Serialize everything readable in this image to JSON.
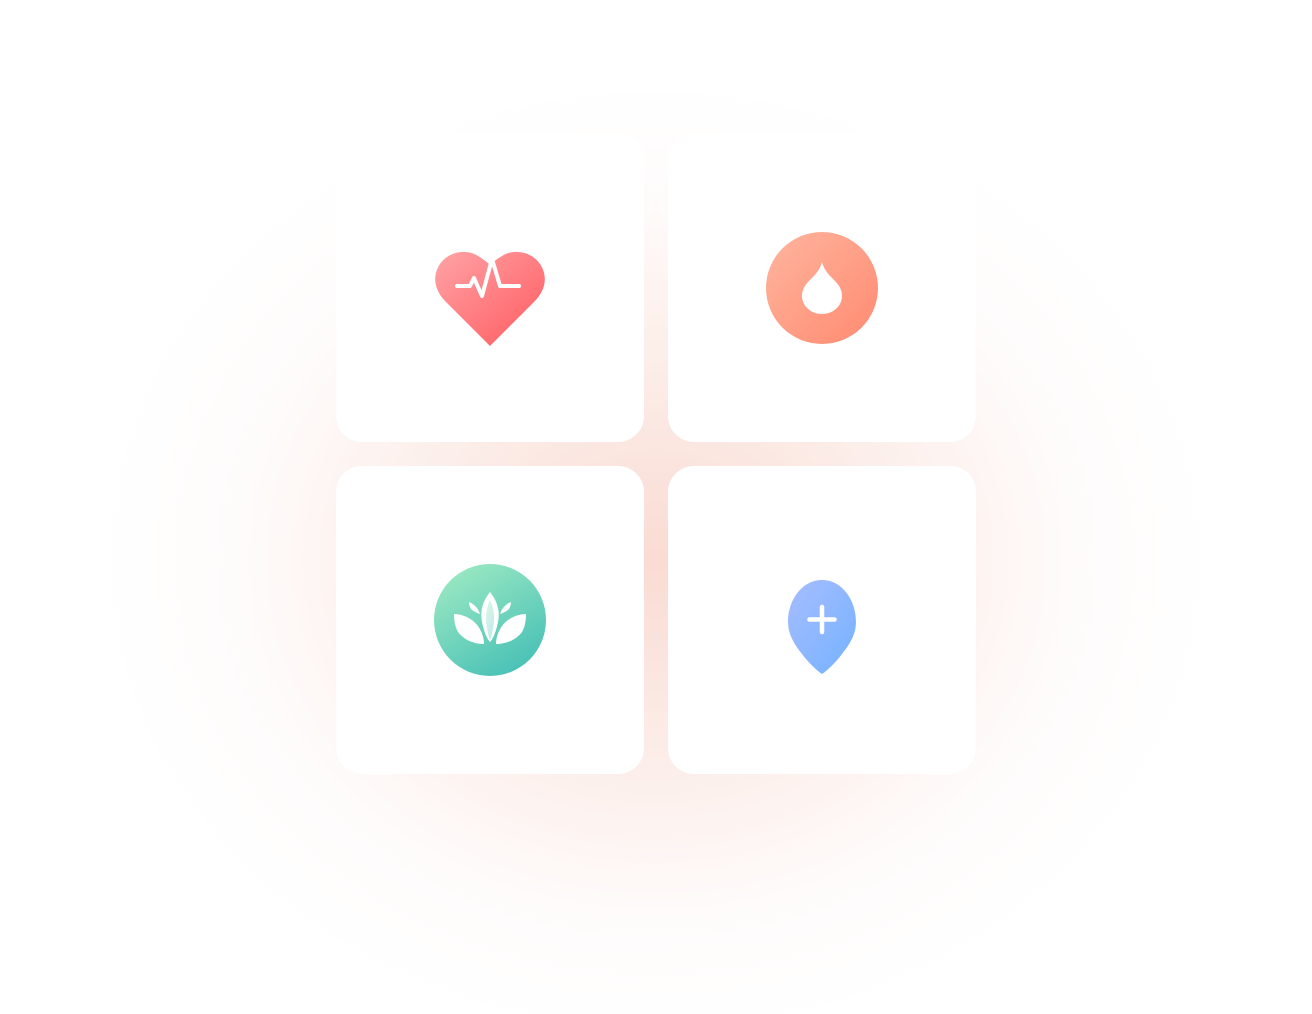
{
  "tiles": [
    {
      "icon": "heart-rate-icon",
      "color_start": "#ffa3a6",
      "color_end": "#ff5a5f"
    },
    {
      "icon": "water-drop-icon",
      "color_start": "#ffb09a",
      "color_end": "#ff8a70"
    },
    {
      "icon": "lotus-icon",
      "color_start": "#9ce9c2",
      "color_end": "#45bfb6"
    },
    {
      "icon": "medical-location-pin-icon",
      "color_start": "#a7bdff",
      "color_end": "#74b2ff"
    }
  ]
}
